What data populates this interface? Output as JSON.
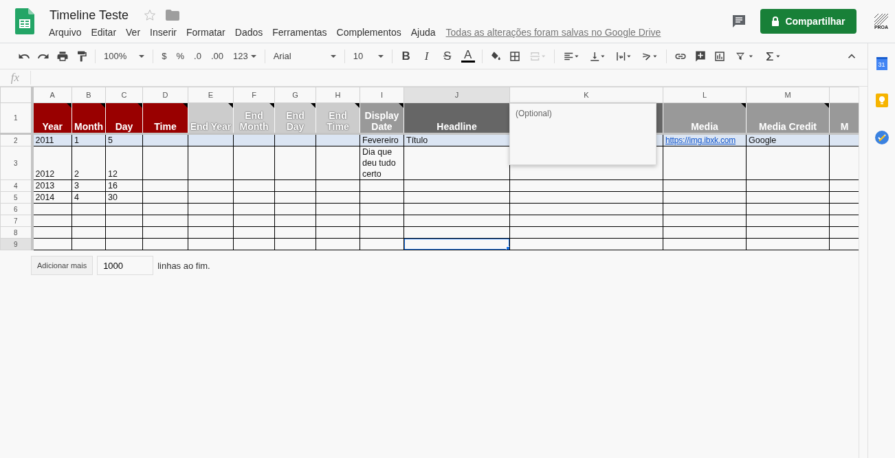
{
  "document": {
    "title": "Timeline Teste",
    "starred": false
  },
  "menu": [
    "Arquivo",
    "Editar",
    "Ver",
    "Inserir",
    "Formatar",
    "Dados",
    "Ferramentas",
    "Complementos",
    "Ajuda"
  ],
  "save_status": "Todas as alterações foram salvas no Google Drive",
  "share_button": "Compartilhar",
  "account": {
    "label": "PROA"
  },
  "toolbar": {
    "zoom": "100%",
    "currency": "$",
    "percent": "%",
    "decrease_decimals": ".0",
    "increase_decimals": ".00",
    "number_format": "123",
    "font": "Arial",
    "font_size": "10",
    "bold": "B",
    "italic": "I",
    "strikethrough": "S",
    "text_color": "A",
    "merge_disabled": true
  },
  "formula_bar": {
    "label": "fx"
  },
  "columns": [
    {
      "letter": "A",
      "header": "Year",
      "color": "#990000",
      "has_note": true
    },
    {
      "letter": "B",
      "header": "Month",
      "color": "#990000",
      "has_note": true
    },
    {
      "letter": "C",
      "header": "Day",
      "color": "#990000",
      "has_note": true
    },
    {
      "letter": "D",
      "header": "Time",
      "color": "#990000",
      "has_note": true
    },
    {
      "letter": "E",
      "header": "End Year",
      "color": "#cccccc",
      "has_note": true
    },
    {
      "letter": "F",
      "header": "End Month",
      "color": "#cccccc",
      "has_note": true
    },
    {
      "letter": "G",
      "header": "End Day",
      "color": "#cccccc",
      "has_note": true
    },
    {
      "letter": "H",
      "header": "End Time",
      "color": "#cccccc",
      "has_note": true
    },
    {
      "letter": "I",
      "header": "Display Date",
      "color": "#999999",
      "has_note": true
    },
    {
      "letter": "J",
      "header": "Headline",
      "color": "#666666",
      "has_note": false
    },
    {
      "letter": "K",
      "color": "#666666",
      "has_note": false
    },
    {
      "letter": "L",
      "header": "Media",
      "color": "#999999",
      "has_note": true
    },
    {
      "letter": "M",
      "header": "Media Credit",
      "color": "#999999",
      "has_note": true
    },
    {
      "header": "M",
      "color": "#999999",
      "has_note": false
    }
  ],
  "header_row_number": "1",
  "rows": [
    {
      "number": "2",
      "highlighted": true,
      "cells": {
        "A": {
          "text": "2011",
          "kind": "text",
          "selected": false
        },
        "B": {
          "text": "1",
          "kind": "text",
          "selected": false
        },
        "C": {
          "text": "5",
          "kind": "text",
          "selected": false
        },
        "I": {
          "text": "Fevereiro",
          "kind": "text",
          "selected": false
        },
        "J": {
          "text": "Título",
          "kind": "text",
          "selected": false
        },
        "L": {
          "text": "https://img.ibxk.com",
          "kind": "link",
          "selected": false
        },
        "M": {
          "text": "Google",
          "kind": "text",
          "selected": false
        }
      }
    },
    {
      "number": "3",
      "highlighted": false,
      "cells": {
        "A": {
          "text": "2012",
          "kind": "text",
          "selected": false
        },
        "B": {
          "text": "2",
          "kind": "text",
          "selected": false
        },
        "C": {
          "text": "12",
          "kind": "text",
          "selected": false
        },
        "I": {
          "text": "Dia que deu tudo certo",
          "kind": "text",
          "selected": false
        }
      }
    },
    {
      "number": "4",
      "highlighted": false,
      "cells": {
        "A": {
          "text": "2013",
          "kind": "text",
          "selected": false
        },
        "B": {
          "text": "3",
          "kind": "text",
          "selected": false
        },
        "C": {
          "text": "16",
          "kind": "text",
          "selected": false
        }
      }
    },
    {
      "number": "5",
      "highlighted": false,
      "cells": {
        "A": {
          "text": "2014",
          "kind": "text",
          "selected": false
        },
        "B": {
          "text": "4",
          "kind": "text",
          "selected": false
        },
        "C": {
          "text": "30",
          "kind": "text",
          "selected": false
        }
      }
    },
    {
      "number": "6",
      "highlighted": false
    },
    {
      "number": "7",
      "highlighted": false
    },
    {
      "number": "8",
      "highlighted": false
    },
    {
      "number": "9",
      "highlighted": false,
      "cells": {
        "J": {
          "kind": "empty",
          "selected": true
        }
      }
    }
  ],
  "note": {
    "text": "(Optional)"
  },
  "add_rows": {
    "button": "Adicionar mais",
    "value": "1000",
    "suffix": "linhas ao fim."
  },
  "side_panel": {
    "calendar_day": "31"
  }
}
